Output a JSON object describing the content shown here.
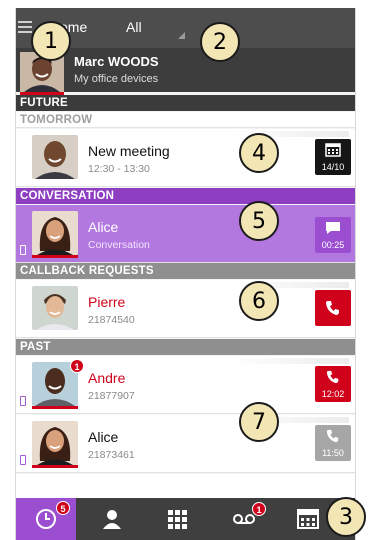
{
  "topbar": {
    "tab_home": "ome",
    "tab_all": "All"
  },
  "profile": {
    "name": "Marc WOODS",
    "subtitle": "My office devices"
  },
  "sections": {
    "future": "FUTURE",
    "tomorrow": "TOMORROW",
    "conversation": "CONVERSATION",
    "callback": "CALLBACK REQUESTS",
    "past": "PAST"
  },
  "items": [
    {
      "name": "New meeting",
      "sub": "12:30 - 13:30",
      "tile_text": "14/10",
      "tile_icon": "calendar-icon"
    },
    {
      "name": "Alice",
      "sub": "Conversation",
      "tile_text": "00:25",
      "tile_icon": "chat-bubble-icon"
    },
    {
      "name": "Pierre",
      "sub": "21874540",
      "tile_icon": "phone-icon"
    },
    {
      "name": "Andre",
      "sub": "21877907",
      "tile_text": "12:02",
      "tile_icon": "phone-outgoing-icon",
      "badge": "1"
    },
    {
      "name": "Alice",
      "sub": "21873461",
      "tile_text": "11:50",
      "tile_icon": "phone-outgoing-icon"
    }
  ],
  "bottom_nav": [
    {
      "name": "history",
      "icon": "clock-icon",
      "badge": "5"
    },
    {
      "name": "contacts",
      "icon": "person-icon"
    },
    {
      "name": "dialpad",
      "icon": "keypad-icon"
    },
    {
      "name": "voicemail",
      "icon": "voicemail-icon",
      "badge": "1"
    },
    {
      "name": "calendar",
      "icon": "calendar-icon"
    }
  ],
  "callouts": [
    "1",
    "2",
    "3",
    "4",
    "5",
    "6",
    "7"
  ],
  "colors": {
    "accent_purple": "#9b4fd0",
    "missed_red": "#d0021b",
    "topbar": "#4d4d4d"
  }
}
